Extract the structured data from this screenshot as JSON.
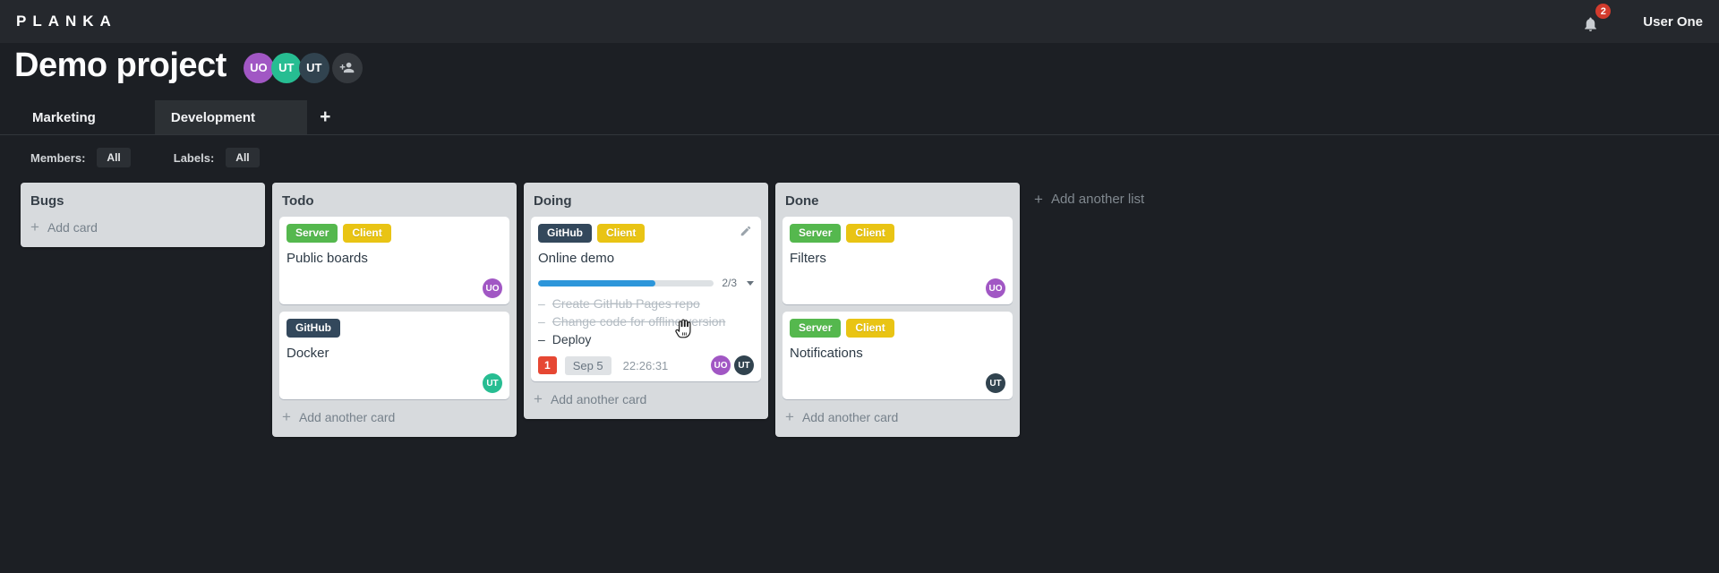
{
  "topbar": {
    "logo": "PLANKA",
    "notification_count": "2",
    "user_name": "User One"
  },
  "header": {
    "title": "Demo project",
    "members": [
      {
        "initials": "UO",
        "color": "#a157c4"
      },
      {
        "initials": "UT",
        "color": "#27bd92"
      },
      {
        "initials": "UT",
        "color": "#31434f"
      }
    ]
  },
  "tabs": {
    "items": [
      {
        "label": "Marketing",
        "active": false
      },
      {
        "label": "Development",
        "active": true
      }
    ],
    "add_label": "+"
  },
  "filterbar": {
    "members_label": "Members:",
    "members_value": "All",
    "labels_label": "Labels:",
    "labels_value": "All"
  },
  "glyphs": {
    "plus": "+",
    "task_dash": "–"
  },
  "board": {
    "add_list_label": "Add another list",
    "lists": [
      {
        "name": "Bugs",
        "add_card_label": "Add card",
        "cards": []
      },
      {
        "name": "Todo",
        "add_card_label": "Add another card",
        "cards": [
          {
            "title": "Public boards",
            "labels": [
              "Server",
              "Client"
            ],
            "member": "UO"
          },
          {
            "title": "Docker",
            "labels": [
              "GitHub"
            ],
            "member": "UT"
          }
        ]
      },
      {
        "name": "Doing",
        "add_card_label": "Add another card",
        "cards": [
          {
            "title": "Online demo",
            "labels": [
              "GitHub",
              "Client"
            ],
            "progress": {
              "fraction": "2/3",
              "percent": 66.7
            },
            "tasks": [
              {
                "text": "Create GitHub Pages repo",
                "done": true
              },
              {
                "text": "Change code for offline version",
                "done": true
              },
              {
                "text": "Deploy",
                "done": false
              }
            ],
            "badges": {
              "notifications": "1",
              "due_date": "Sep 5",
              "timer": "22:26:31"
            },
            "members": [
              "UO",
              "UT"
            ]
          }
        ]
      },
      {
        "name": "Done",
        "add_card_label": "Add another card",
        "cards": [
          {
            "title": "Filters",
            "labels": [
              "Server",
              "Client"
            ],
            "member": "UO"
          },
          {
            "title": "Notifications",
            "labels": [
              "Server",
              "Client"
            ],
            "member": "UT"
          }
        ]
      }
    ]
  },
  "colors": {
    "topbar_bg": "#25282d",
    "board_bg": "#1c1f24",
    "list_bg": "#d7dadd",
    "label_server": "#55b84e",
    "label_client": "#e9c414",
    "label_github": "#33485c",
    "avatar_purple": "#a157c4",
    "avatar_teal": "#27bd92",
    "avatar_dark": "#31434f",
    "progress_blue": "#2d96da",
    "notification_red": "#d23b2d",
    "card_badge_red": "#e64733"
  }
}
